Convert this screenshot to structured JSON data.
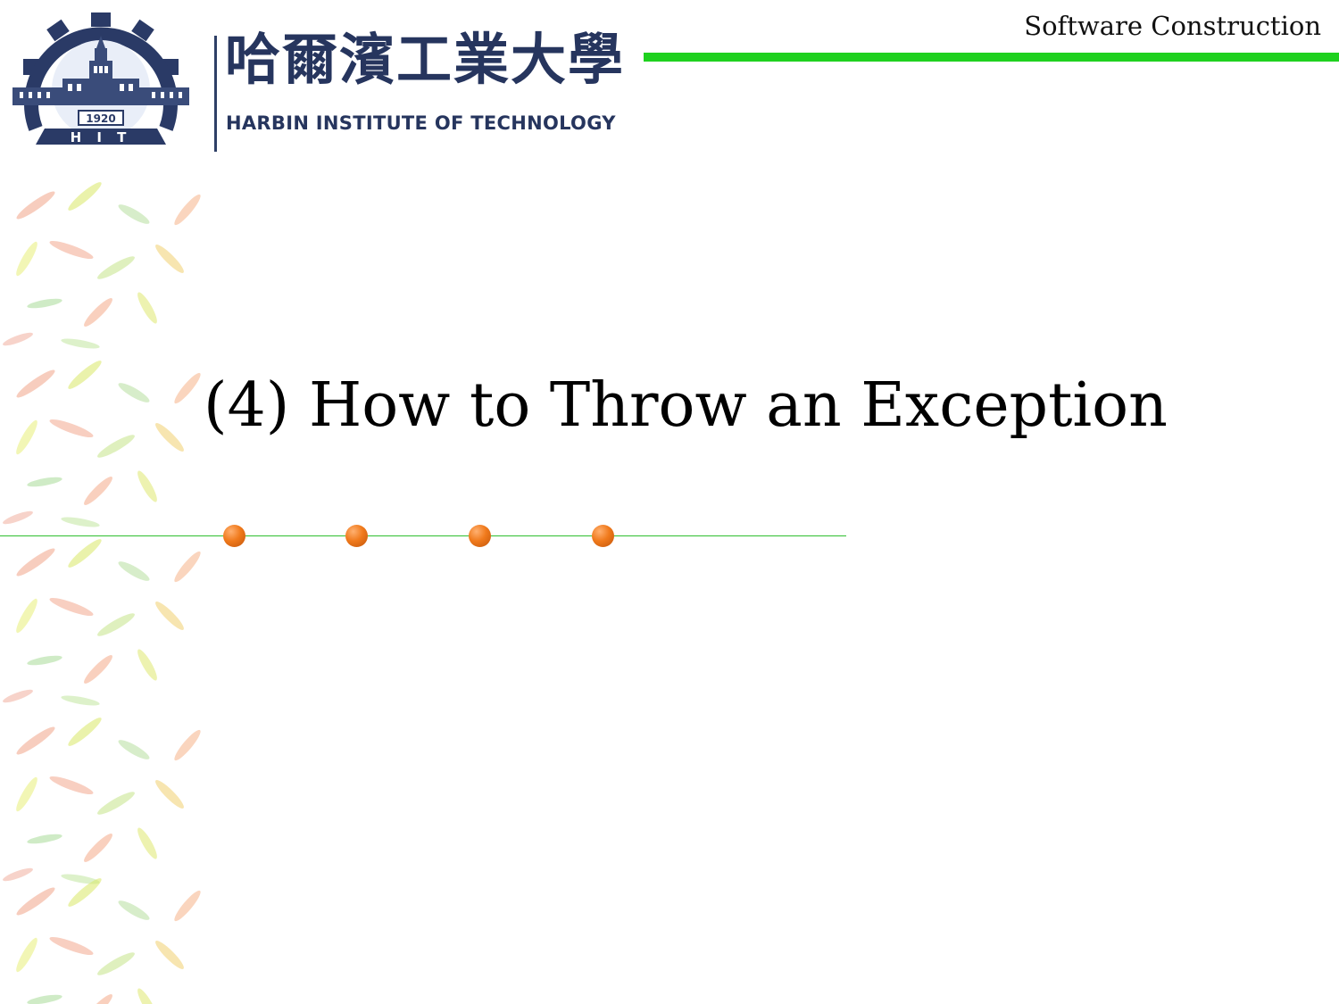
{
  "header": {
    "course_title": "Software Construction",
    "accent_color": "#1fd11f"
  },
  "logo": {
    "name_cn": "哈爾濱工業大學",
    "name_en": "HARBIN INSTITUTE OF TECHNOLOGY",
    "seal_year": "1920",
    "seal_initials": "H I T",
    "color": "#26355e"
  },
  "slide": {
    "title": "(4) How to Throw an Exception",
    "bullet_count": 4,
    "bullet_color": "#f07a1c"
  }
}
